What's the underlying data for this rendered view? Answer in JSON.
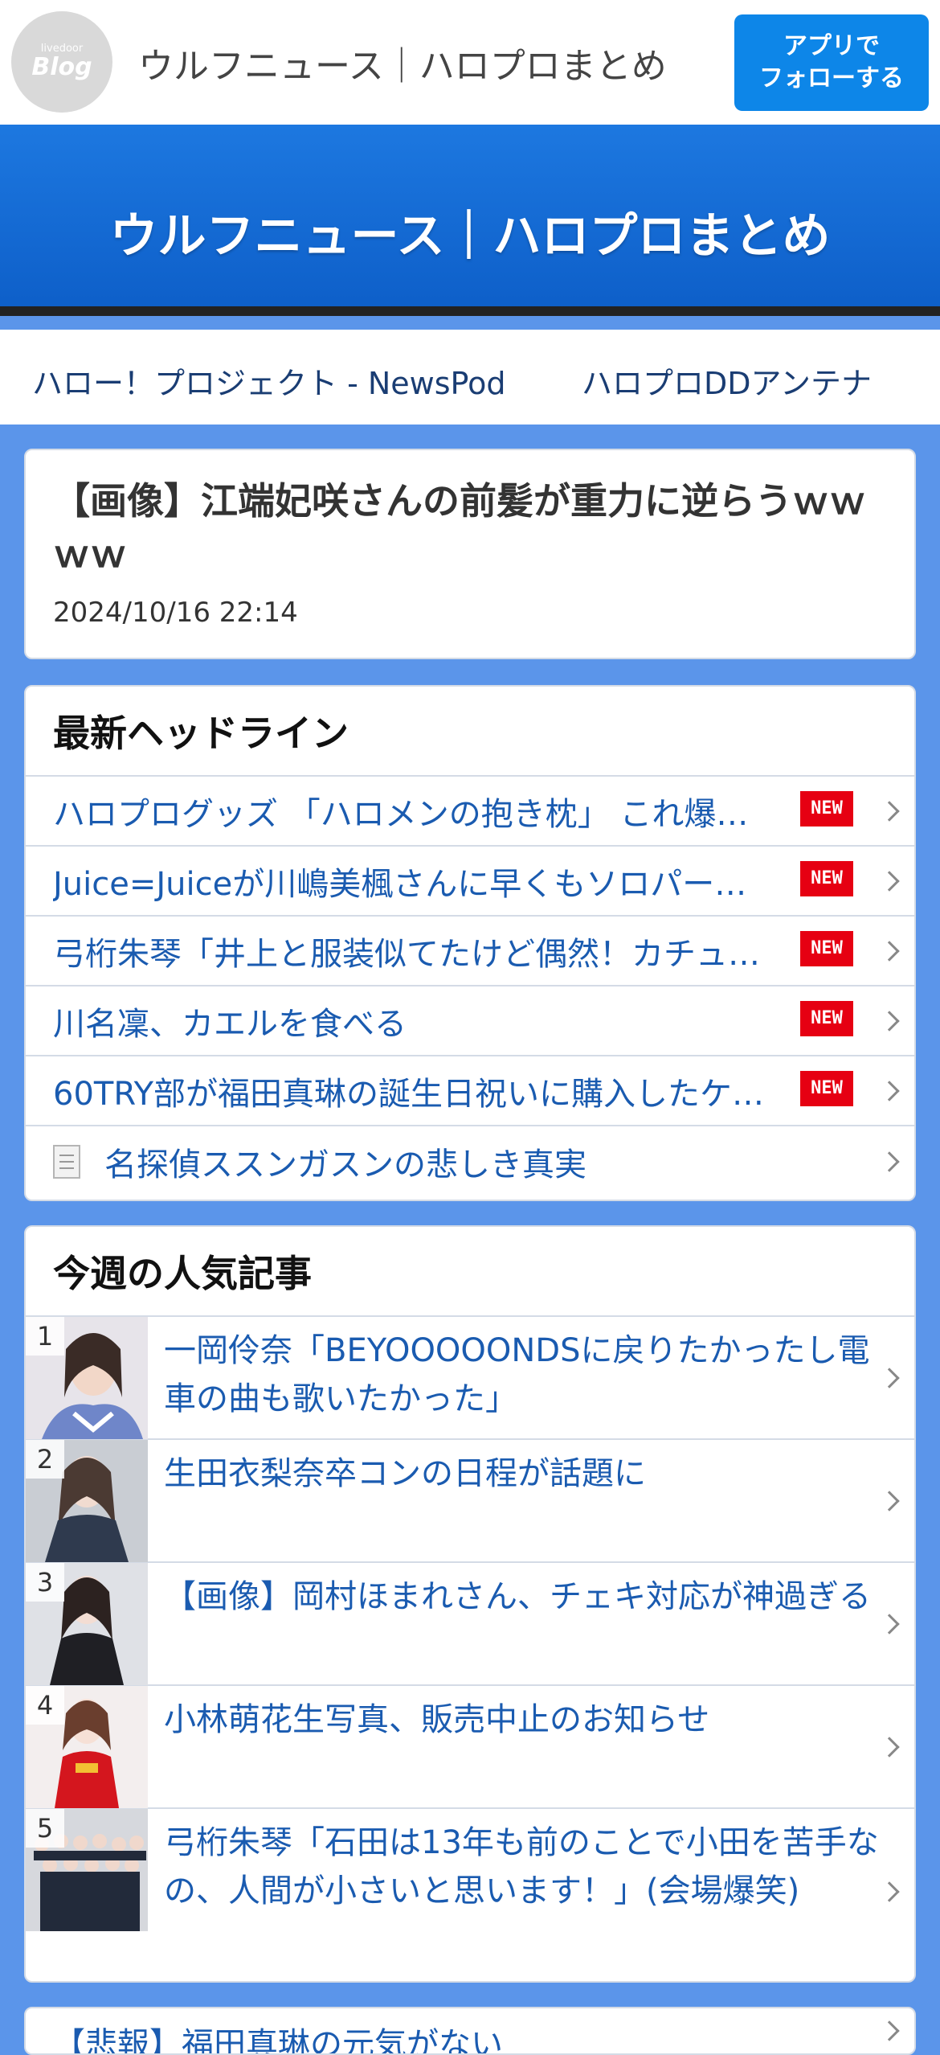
{
  "header": {
    "logo_small": "livedoor",
    "logo_big": "Blog",
    "title": "ウルフニュース｜ハロプロまとめ",
    "follow_line1": "アプリで",
    "follow_line2": "フォローする"
  },
  "banner": {
    "title": "ウルフニュース｜ハロプロまとめ"
  },
  "links": [
    "ハロー！プロジェクト - NewsPod",
    "ハロプロDDアンテナ"
  ],
  "article": {
    "title": "【画像】江端妃咲さんの前髪が重力に逆らうｗｗｗｗ",
    "date": "2024/10/16 22:14"
  },
  "headlines": {
    "heading": "最新ヘッドライン",
    "new_label": "NEW",
    "items": [
      "ハロプログッズ 「ハロメンの抱き枕」 これ爆…",
      "Juice=Juiceが川嶋美楓さんに早くもソロパー…",
      "弓桁朱琴「井上と服装似てたけど偶然！カチュ…",
      "川名凜、カエルを食べる",
      "60TRY部が福田真琳の誕生日祝いに購入したケ…",
      "名探偵ススンガスンの悲しき真実"
    ]
  },
  "popular": {
    "heading": "今週の人気記事",
    "items": [
      {
        "rank": "1",
        "title": "一岡伶奈「BEYOOOOONDSに戻りたかったし電車の曲も歌いたかった」"
      },
      {
        "rank": "2",
        "title": "生田衣梨奈卒コンの日程が話題に"
      },
      {
        "rank": "3",
        "title": "【画像】岡村ほまれさん、チェキ対応が神過ぎる"
      },
      {
        "rank": "4",
        "title": "小林萌花生写真、販売中止のお知らせ"
      },
      {
        "rank": "5",
        "title": "弓桁朱琴「石田は13年も前のことで小田を苦手なの、人間が小さいと思います！」(会場爆笑)"
      }
    ]
  },
  "next_card": {
    "text": "【悲報】福田真琳の元気がない"
  }
}
